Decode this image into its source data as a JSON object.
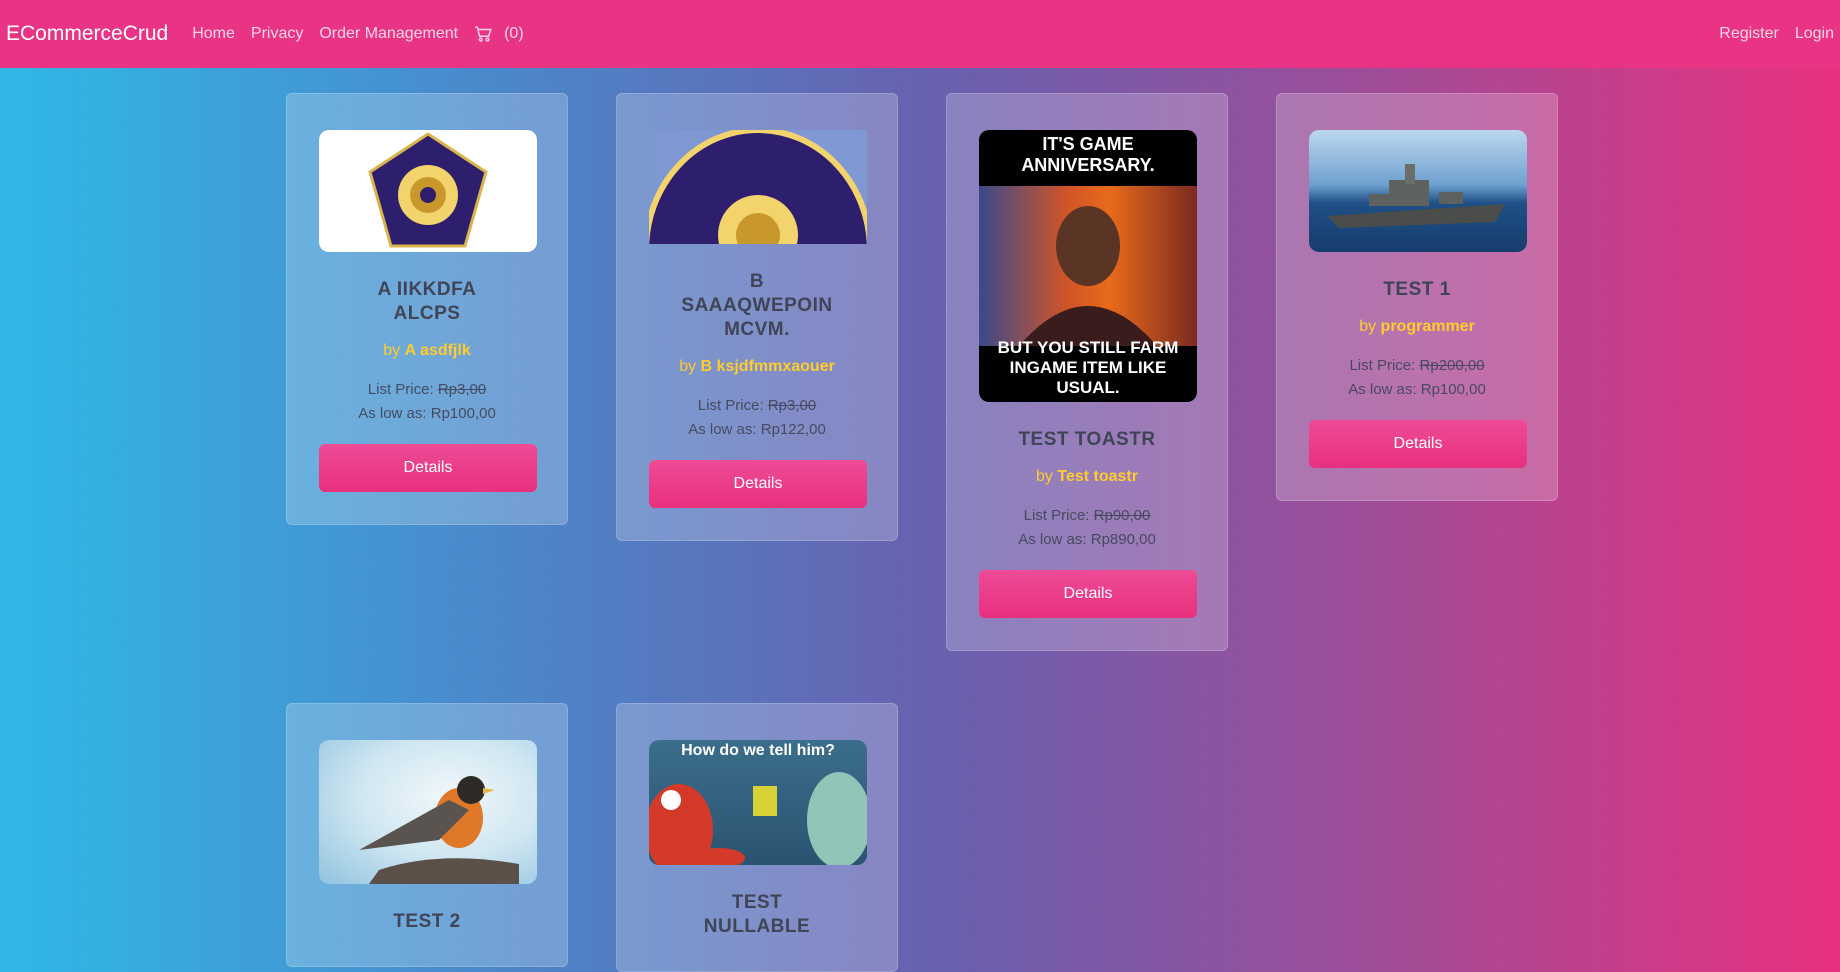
{
  "nav": {
    "brand": "ECommerceCrud",
    "home": "Home",
    "privacy": "Privacy",
    "orders": "Order Management",
    "cart_count": "(0)",
    "register": "Register",
    "login": "Login"
  },
  "labels": {
    "list_price": "List Price:",
    "as_low_as": "As low as:",
    "by": "by",
    "details": "Details"
  },
  "products": [
    {
      "title": "A IIKKDFA ALCPS",
      "author": "A asdfjlk",
      "list_price": "Rp3,00",
      "low_price": "Rp100,00"
    },
    {
      "title": "B SAAAQWEPOIN MCVM.",
      "author": "B ksjdfmmxaouer",
      "list_price": "Rp3,00",
      "low_price": "Rp122,00"
    },
    {
      "title": "TEST TOASTR",
      "author": "Test toastr",
      "list_price": "Rp90,00",
      "low_price": "Rp890,00",
      "image_caption_top": "IT'S GAME ANNIVERSARY.",
      "image_caption_bottom": "BUT YOU STILL FARM INGAME ITEM LIKE USUAL."
    },
    {
      "title": "TEST 1",
      "author": "programmer",
      "list_price": "Rp200,00",
      "low_price": "Rp100,00"
    },
    {
      "title": "TEST 2"
    },
    {
      "title": "TEST NULLABLE",
      "image_caption": "How do we tell him?"
    }
  ]
}
